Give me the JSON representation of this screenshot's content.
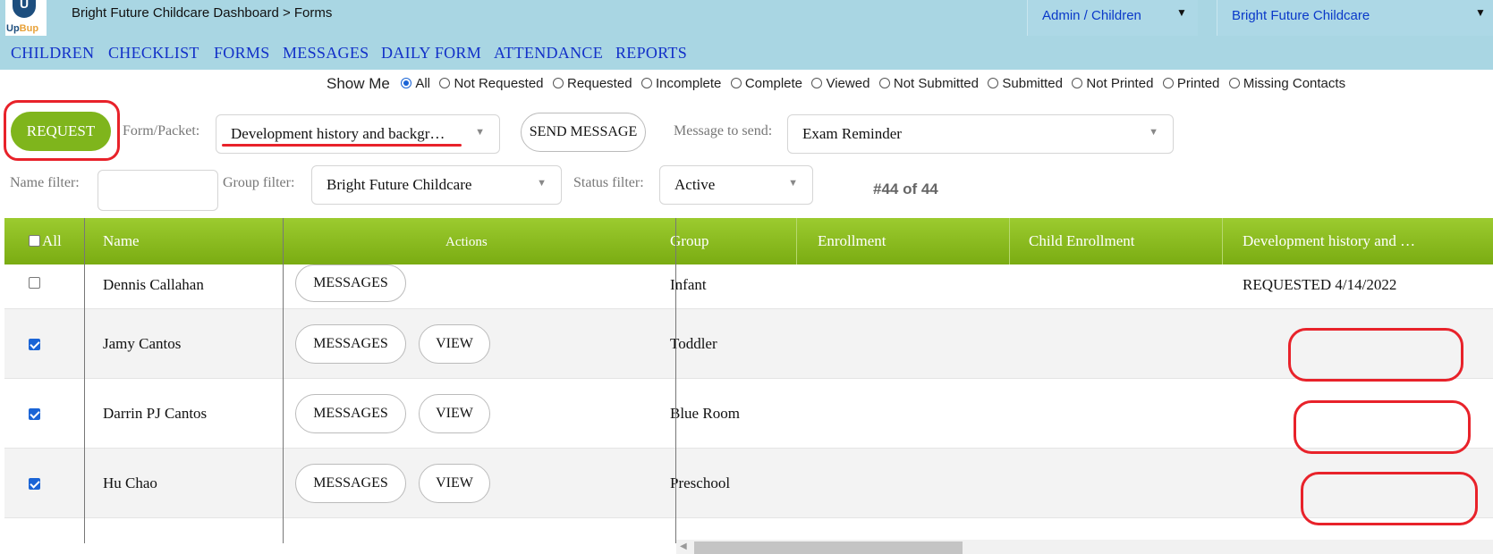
{
  "header": {
    "logo_text_a": "Up",
    "logo_text_b": "Bup",
    "breadcrumb": "Bright Future Childcare Dashboard > Forms",
    "role_select": "Admin / Children",
    "center_select": "Bright Future Childcare",
    "caret": "▼"
  },
  "nav": [
    "CHILDREN",
    "CHECKLIST",
    "FORMS",
    "MESSAGES",
    "DAILY FORM",
    "ATTENDANCE",
    "REPORTS"
  ],
  "show_me": {
    "label": "Show Me",
    "options": [
      "All",
      "Not Requested",
      "Requested",
      "Incomplete",
      "Complete",
      "Viewed",
      "Not Submitted",
      "Submitted",
      "Not Printed",
      "Printed",
      "Missing Contacts"
    ],
    "selected": "All"
  },
  "toolbar": {
    "request_label": "REQUEST",
    "form_packet_label": "Form/Packet:",
    "form_packet_value": "Development history and backgr…",
    "send_message_label": "SEND MESSAGE",
    "message_label": "Message to send:",
    "message_value": "Exam Reminder"
  },
  "filters": {
    "name_label": "Name filter:",
    "name_value": "",
    "group_label": "Group filter:",
    "group_value": "Bright Future Childcare",
    "status_label": "Status filter:",
    "status_value": "Active",
    "count": "#44 of 44"
  },
  "table": {
    "headers": [
      "All",
      "Name",
      "Actions",
      "Group",
      "Enrollment",
      "Child Enrollment",
      "Development history and …"
    ],
    "rows": [
      {
        "checked": false,
        "name": "Dennis Callahan",
        "actions": [
          "MESSAGES"
        ],
        "group": "Infant",
        "dev_status": "REQUESTED 4/14/2022"
      },
      {
        "checked": true,
        "name": "Jamy Cantos",
        "actions": [
          "MESSAGES",
          "VIEW"
        ],
        "group": "Toddler",
        "dev_status": ""
      },
      {
        "checked": true,
        "name": "Darrin PJ Cantos",
        "actions": [
          "MESSAGES",
          "VIEW"
        ],
        "group": "Blue Room",
        "dev_status": ""
      },
      {
        "checked": true,
        "name": "Hu Chao",
        "actions": [
          "MESSAGES",
          "VIEW"
        ],
        "group": "Preschool",
        "dev_status": ""
      }
    ]
  },
  "colors": {
    "header_bg": "#a9d6e3",
    "nav_link": "#1230c8",
    "green": "#7fb51c",
    "annotation_red": "#e8222a"
  }
}
